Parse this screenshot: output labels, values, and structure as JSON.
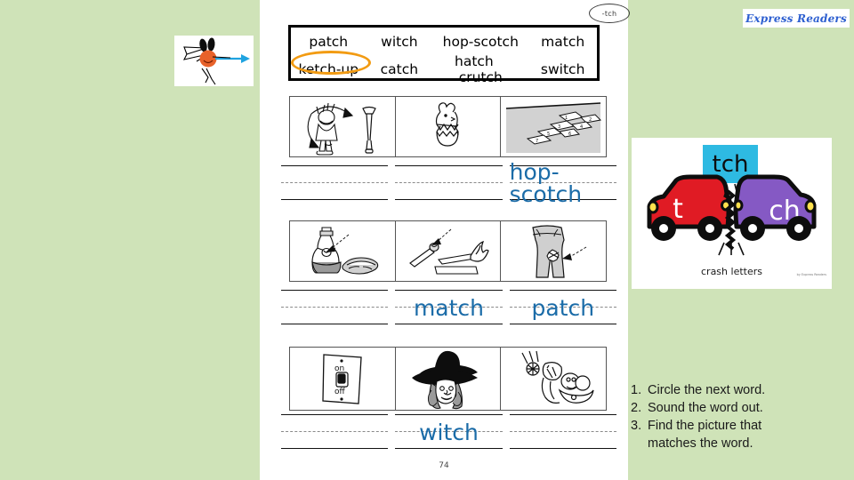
{
  "slide": {
    "background_color": "#cfe3b8",
    "accent_blue": "#1b6ca8",
    "accent_orange": "#f29b12",
    "banner_cyan": "#2ebae2"
  },
  "logo": {
    "text": "Express Readers"
  },
  "worksheet": {
    "tab_label": "-tch",
    "page_number": "74",
    "word_box": {
      "row1": [
        "patch",
        "witch",
        "hop-scotch",
        "match"
      ],
      "row2": [
        "ketch-up",
        "catch",
        "hatch",
        "crutch",
        "switch"
      ],
      "circled_word": "ketch-up"
    },
    "rows": [
      {
        "pictures": [
          "crutch-picture",
          "hatch-picture",
          "hop-scotch-picture"
        ],
        "answers": [
          "",
          "",
          "hop-scotch"
        ]
      },
      {
        "pictures": [
          "ketchup-picture",
          "match-picture",
          "patch-picture"
        ],
        "answers": [
          "",
          "match",
          "patch"
        ]
      },
      {
        "pictures": [
          "switch-picture",
          "witch-picture",
          "catch-picture"
        ],
        "answers": [
          "",
          "witch",
          ""
        ]
      }
    ]
  },
  "poster": {
    "banner_text": "tch",
    "left_car_letter": "t",
    "right_car_letter": "ch",
    "caption": "crash letters",
    "credit": "by Express\nReaders"
  },
  "instructions": [
    {
      "number": "1.",
      "text": "Circle the next word."
    },
    {
      "number": "2.",
      "text": "Sound the word out."
    },
    {
      "number": "3.",
      "text": "Find the picture that",
      "continuation": "matches the word."
    }
  ],
  "bug_card": {
    "name": "bug-with-arrow-drawing"
  }
}
